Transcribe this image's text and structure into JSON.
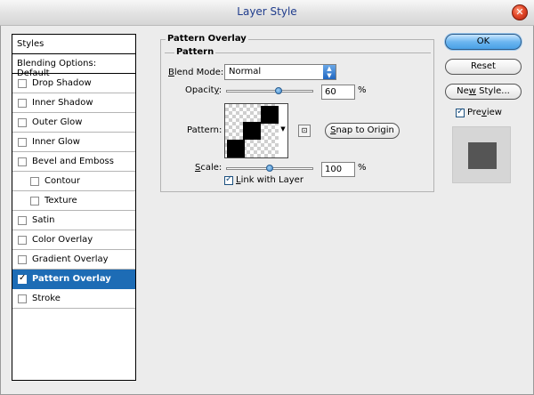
{
  "window": {
    "title": "Layer Style"
  },
  "styles_panel": {
    "header": "Styles",
    "blending_options": "Blending Options: Default",
    "items": [
      {
        "label": "Drop Shadow",
        "checked": false,
        "indent": false,
        "selected": false
      },
      {
        "label": "Inner Shadow",
        "checked": false,
        "indent": false,
        "selected": false
      },
      {
        "label": "Outer Glow",
        "checked": false,
        "indent": false,
        "selected": false
      },
      {
        "label": "Inner Glow",
        "checked": false,
        "indent": false,
        "selected": false
      },
      {
        "label": "Bevel and Emboss",
        "checked": false,
        "indent": false,
        "selected": false
      },
      {
        "label": "Contour",
        "checked": false,
        "indent": true,
        "selected": false
      },
      {
        "label": "Texture",
        "checked": false,
        "indent": true,
        "selected": false
      },
      {
        "label": "Satin",
        "checked": false,
        "indent": false,
        "selected": false
      },
      {
        "label": "Color Overlay",
        "checked": false,
        "indent": false,
        "selected": false
      },
      {
        "label": "Gradient Overlay",
        "checked": false,
        "indent": false,
        "selected": false
      },
      {
        "label": "Pattern Overlay",
        "checked": true,
        "indent": false,
        "selected": true
      },
      {
        "label": "Stroke",
        "checked": false,
        "indent": false,
        "selected": false
      }
    ]
  },
  "pattern_overlay": {
    "group_title": "Pattern Overlay",
    "section_title": "Pattern",
    "blend_mode_label_prefix": "B",
    "blend_mode_label_rest": "lend Mode:",
    "blend_mode_value": "Normal",
    "opacity_label_prefix": "Opacit",
    "opacity_label_underlined": "y",
    "opacity_label_suffix": ":",
    "opacity_value": "60",
    "opacity_fraction": 0.6,
    "pattern_label": "Pattern:",
    "snap_button_prefix": "S",
    "snap_button_rest": "nap to Origin",
    "scale_label_prefix": "S",
    "scale_label_rest": "cale:",
    "scale_value": "100",
    "scale_fraction": 0.5,
    "percent_sign": "%",
    "link_label_prefix": "L",
    "link_label_rest": "ink with Layer",
    "link_checked": true
  },
  "buttons": {
    "ok": "OK",
    "reset": "Reset",
    "new_style_prefix": "Ne",
    "new_style_underlined": "w",
    "new_style_suffix": " Style...",
    "preview_prefix": "Pre",
    "preview_underlined": "v",
    "preview_suffix": "iew",
    "preview_checked": true
  },
  "colors": {
    "selected_row": "#1d6cb5",
    "title_text": "#1f3c8c",
    "preview_swatch": "#555555"
  }
}
